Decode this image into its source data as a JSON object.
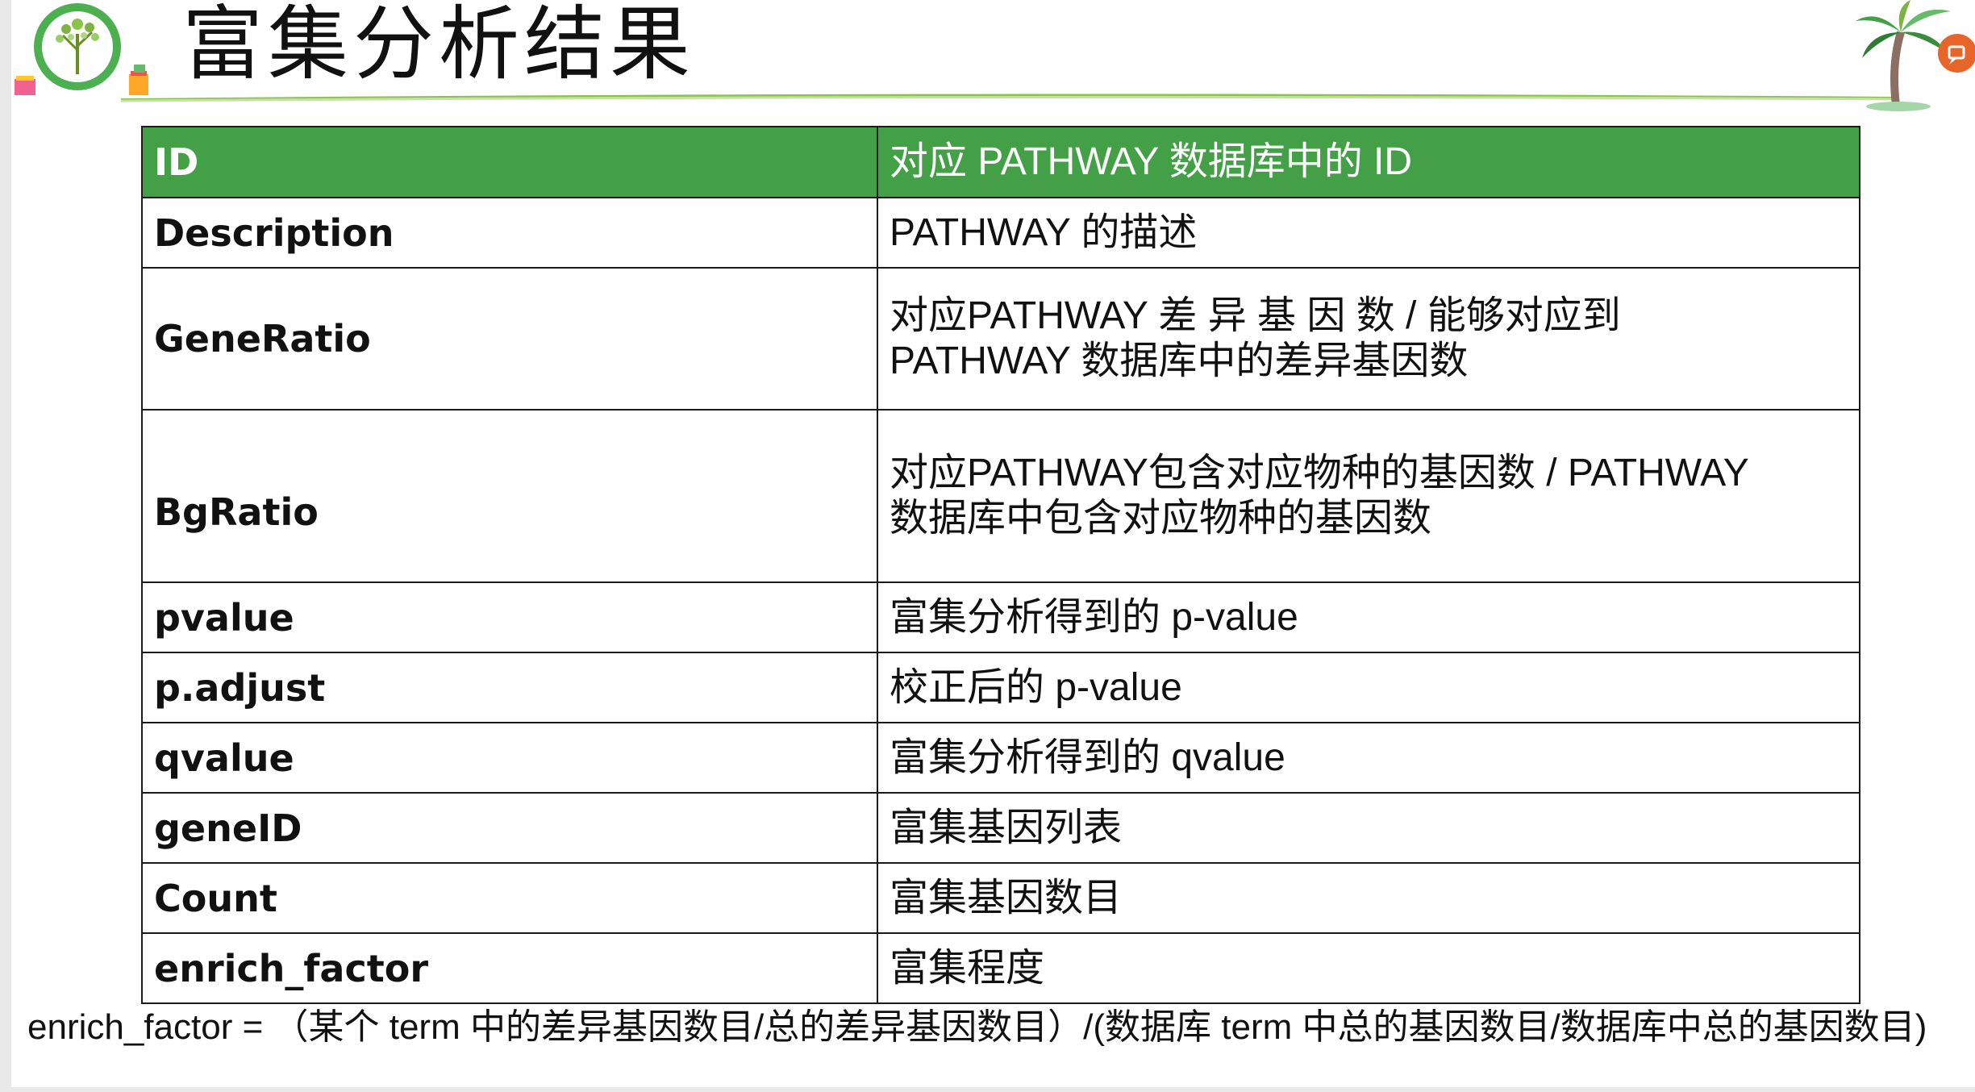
{
  "header": {
    "title": "富集分析结果"
  },
  "table": {
    "header_row": {
      "term": "ID",
      "desc": "对应 PATHWAY 数据库中的 ID"
    },
    "rows": [
      {
        "term": "Description",
        "desc": "PATHWAY 的描述"
      },
      {
        "term": "GeneRatio",
        "desc_line1": "对应PATHWAY 差 异 基 因 数 / 能够对应到",
        "desc_line2": "PATHWAY 数据库中的差异基因数"
      },
      {
        "term": "BgRatio",
        "desc_line1": "对应PATHWAY包含对应物种的基因数 / PATHWAY",
        "desc_line2": "数据库中包含对应物种的基因数"
      },
      {
        "term": "pvalue",
        "desc": "富集分析得到的 p-value"
      },
      {
        "term": "p.adjust",
        "desc": "校正后的 p-value"
      },
      {
        "term": "qvalue",
        "desc": "富集分析得到的 qvalue"
      },
      {
        "term": "geneID",
        "desc": "富集基因列表"
      },
      {
        "term": "Count",
        "desc": "富集基因数目"
      },
      {
        "term": "enrich_factor",
        "desc": "富集程度"
      }
    ]
  },
  "footnote": "enrich_factor = （某个 term 中的差异基因数目/总的差异基因数目）/(数据库 term 中总的基因数目/数据库中总的基因数目)",
  "colors": {
    "header_green": "#43a047",
    "accent_line": "#6abf3a",
    "badge_orange": "#e8652a"
  },
  "icons": {
    "logo": "biotrainee-tree-logo-icon",
    "palm": "palm-tree-icon",
    "badge": "orange-chat-badge-icon"
  }
}
